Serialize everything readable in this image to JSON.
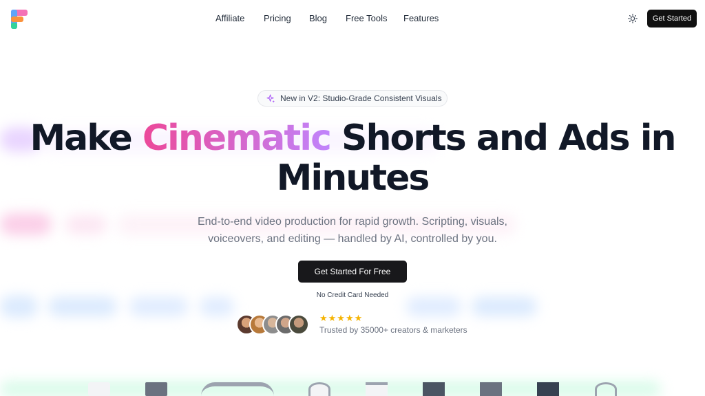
{
  "nav": {
    "items": [
      "Affiliate",
      "Pricing",
      "Blog",
      "Free Tools",
      "Features"
    ],
    "cta_label": "Get Started"
  },
  "hero": {
    "badge": "New in V2: Studio-Grade Consistent Visuals",
    "headline_before": "Make ",
    "headline_accent": "Cinematic",
    "headline_after": " Shorts and Ads in Minutes",
    "subtitle": "End-to-end video production for rapid growth. Scripting, visuals, voiceovers, and editing — handled by AI, controlled by you.",
    "cta_label": "Get Started For Free",
    "note": "No Credit Card Needed",
    "rating_stars": 5,
    "trusted": "Trusted by 35000+ creators & marketers"
  },
  "colors": {
    "accent_pink": "#ec4899",
    "accent_purple": "#c084fc",
    "button_dark": "#18181b",
    "star": "#f5b301"
  },
  "icons": [
    "logo-icon",
    "sun-icon",
    "sparkle-icon"
  ]
}
